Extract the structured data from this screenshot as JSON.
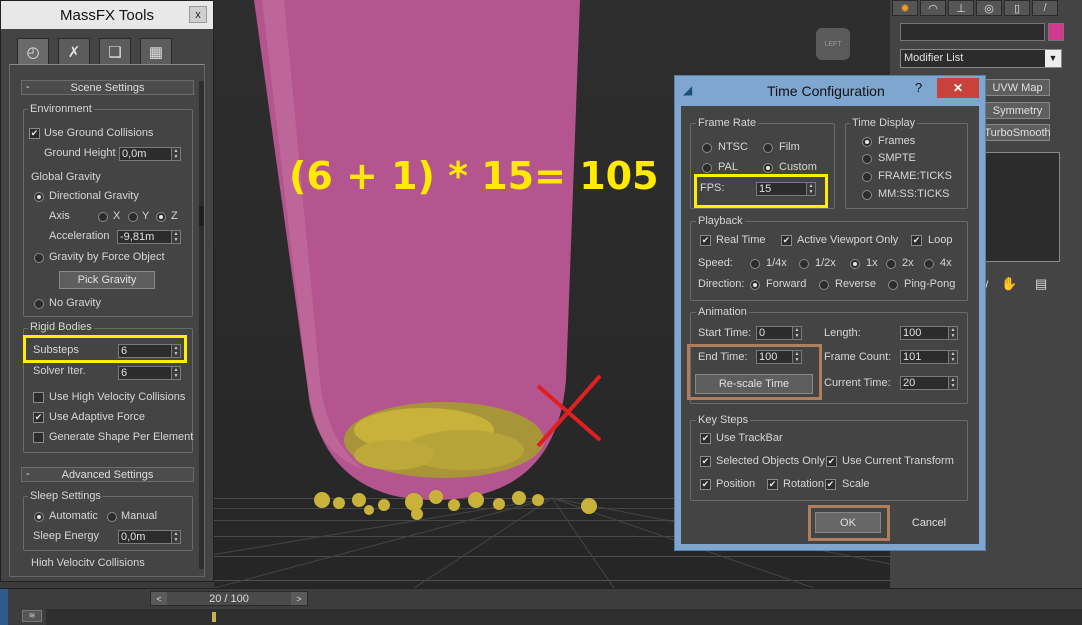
{
  "massfx": {
    "title": "MassFX Tools",
    "close": "x",
    "tabs": [
      {
        "name": "world-tab",
        "glyph": "◴"
      },
      {
        "name": "tools-tab",
        "glyph": "✗"
      },
      {
        "name": "edit-tab",
        "glyph": "❑"
      },
      {
        "name": "display-tab",
        "glyph": "▦"
      }
    ],
    "scene_settings": {
      "header": "Scene Settings",
      "minus": "-",
      "environment": {
        "label": "Environment",
        "use_ground_collisions": "Use Ground Collisions",
        "ground_height_label": "Ground Height",
        "ground_height": "0,0m",
        "global_gravity": "Global Gravity",
        "directional_gravity": "Directional Gravity",
        "axis_label": "Axis",
        "axis_x": "X",
        "axis_y": "Y",
        "axis_z": "Z",
        "acceleration_label": "Acceleration",
        "acceleration": "-9,81m",
        "gravity_by_force": "Gravity by Force Object",
        "pick_gravity": "Pick Gravity",
        "no_gravity": "No Gravity"
      },
      "rigid_bodies": {
        "label": "Rigid Bodies",
        "substeps_label": "Substeps",
        "substeps": "6",
        "solver_label": "Solver Iter.",
        "solver": "6",
        "high_velocity": "Use High Velocity Collisions",
        "adaptive_force": "Use Adaptive Force",
        "generate_shape": "Generate Shape Per Element"
      }
    },
    "advanced_settings": {
      "header": "Advanced Settings",
      "minus": "-",
      "sleep_settings": "Sleep Settings",
      "automatic": "Automatic",
      "manual": "Manual",
      "sleep_energy_label": "Sleep Energy",
      "sleep_energy": "0,0m",
      "high_velocity_collisions": "High Velocity Collisions"
    }
  },
  "viewport": {
    "formula": "(6 + 1) * 15= 105",
    "viewcube_label": "LEFT",
    "colors": {
      "liquid": "#b4558f",
      "particles": "#c9b23a",
      "cross": "#e02020"
    }
  },
  "command_panel": {
    "modifier_list": "Modifier List",
    "modifiers": [
      "UVW Map",
      "Symmetry",
      "TurboSmooth"
    ]
  },
  "time_config": {
    "title": "Time Configuration",
    "help": "?",
    "close": "✕",
    "frame_rate": {
      "label": "Frame Rate",
      "ntsc": "NTSC",
      "film": "Film",
      "pal": "PAL",
      "custom": "Custom",
      "fps_label": "FPS:",
      "fps": "15"
    },
    "time_display": {
      "label": "Time Display",
      "frames": "Frames",
      "smpte": "SMPTE",
      "frame_ticks": "FRAME:TICKS",
      "mmss_ticks": "MM:SS:TICKS"
    },
    "playback": {
      "label": "Playback",
      "real_time": "Real Time",
      "active_viewport": "Active Viewport Only",
      "loop": "Loop",
      "speed_label": "Speed:",
      "speeds": [
        "1/4x",
        "1/2x",
        "1x",
        "2x",
        "4x"
      ],
      "direction_label": "Direction:",
      "forward": "Forward",
      "reverse": "Reverse",
      "ping_pong": "Ping-Pong"
    },
    "animation": {
      "label": "Animation",
      "start_time_label": "Start Time:",
      "start_time": "0",
      "length_label": "Length:",
      "length": "100",
      "end_time_label": "End Time:",
      "end_time": "100",
      "frame_count_label": "Frame Count:",
      "frame_count": "101",
      "rescale": "Re-scale Time",
      "current_time_label": "Current Time:",
      "current_time": "20"
    },
    "key_steps": {
      "label": "Key Steps",
      "use_trackbar": "Use TrackBar",
      "selected_only": "Selected Objects Only",
      "use_current_transform": "Use Current Transform",
      "position": "Position",
      "rotation": "Rotation",
      "scale": "Scale"
    },
    "ok": "OK",
    "cancel": "Cancel"
  },
  "timeline": {
    "prev": "<",
    "next": ">",
    "position": "20 / 100"
  }
}
